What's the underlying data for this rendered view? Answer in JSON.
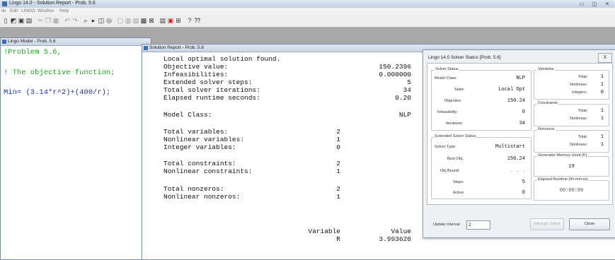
{
  "app": {
    "title": "Lingo 14.0 - Solution Report - Prob. 5.6"
  },
  "window_controls": {
    "minimize": "▭",
    "maximize": "◫",
    "close": "✕"
  },
  "menu": {
    "items": [
      "ile",
      "Edit",
      "LINGO",
      "Window",
      "Help"
    ]
  },
  "model_window": {
    "title": "Lingo Model - Prob. 5.6",
    "lines": [
      "!Problem 5.6,",
      "! The objective function;",
      "Min= (3.14*r^2)+(400/r);"
    ]
  },
  "report_window": {
    "title": "Solution Report - Prob. 5.6",
    "header": "Local optimal solution found.",
    "stats": [
      {
        "label": "Objective value:",
        "value": "150.2396"
      },
      {
        "label": "Infeasibilities:",
        "value": "0.000000"
      },
      {
        "label": "Extended solver steps:",
        "value": "5"
      },
      {
        "label": "Total solver iterations:",
        "value": "34"
      },
      {
        "label": "Elapsed runtime seconds:",
        "value": "0.20"
      }
    ],
    "model_class": {
      "label": "Model Class:",
      "value": "NLP"
    },
    "counts": [
      {
        "label": "Total variables:",
        "value": "2"
      },
      {
        "label": "Nonlinear variables:",
        "value": "1"
      },
      {
        "label": "Integer variables:",
        "value": "0"
      },
      {
        "label": "Total constraints:",
        "value": "2"
      },
      {
        "label": "Nonlinear constraints:",
        "value": "1"
      },
      {
        "label": "Total nonzeros:",
        "value": "2"
      },
      {
        "label": "Nonlinear nonzeros:",
        "value": "1"
      }
    ],
    "table": {
      "col_variable": "Variable",
      "col_value": "Value",
      "row_variable": "R",
      "row_value": "3.993620"
    }
  },
  "status_dialog": {
    "title": "Lingo 14.0 Solver Status [Prob. 5.6]",
    "close_label": "X",
    "solver_status": {
      "legend": "Solver Status",
      "model_class_label": "Model Class:",
      "model_class": "NLP",
      "state_label": "State:",
      "state": "Local Opt",
      "objective_label": "Objective:",
      "objective": "150.24",
      "infeasibility_label": "Infeasibility:",
      "infeasibility": "0",
      "iterations_label": "Iterations:",
      "iterations": "34"
    },
    "extended": {
      "legend": "Extended Solver Status",
      "solver_type_label": "Solver Type:",
      "solver_type": "Multistart",
      "best_obj_label": "Best Obj:",
      "best_obj": "150.24",
      "obj_bound_label": "Obj Bound:",
      "obj_bound": ". . .",
      "steps_label": "Steps:",
      "steps": "5",
      "active_label": "Active:",
      "active": "0"
    },
    "variables": {
      "legend": "Variables",
      "total_label": "Total:",
      "total": "1",
      "nonlinear_label": "Nonlinear:",
      "nonlinear": "1",
      "integers_label": "Integers:",
      "integers": "0"
    },
    "constraints": {
      "legend": "Constraints",
      "total_label": "Total:",
      "total": "1",
      "nonlinear_label": "Nonlinear:",
      "nonlinear": "1"
    },
    "nonzeros": {
      "legend": "Nonzeros",
      "total_label": "Total:",
      "total": "1",
      "nonlinear_label": "Nonlinear:",
      "nonlinear": "1"
    },
    "memory": {
      "legend": "Generator Memory Used (K)",
      "value": "19"
    },
    "runtime": {
      "legend": "Elapsed Runtime (hh:mm:ss)",
      "value": "00:00:00"
    },
    "update_interval_label": "Update Interval:",
    "update_interval": "2",
    "interrupt_label": "Interrupt Solver",
    "close_button_label": "Close"
  }
}
